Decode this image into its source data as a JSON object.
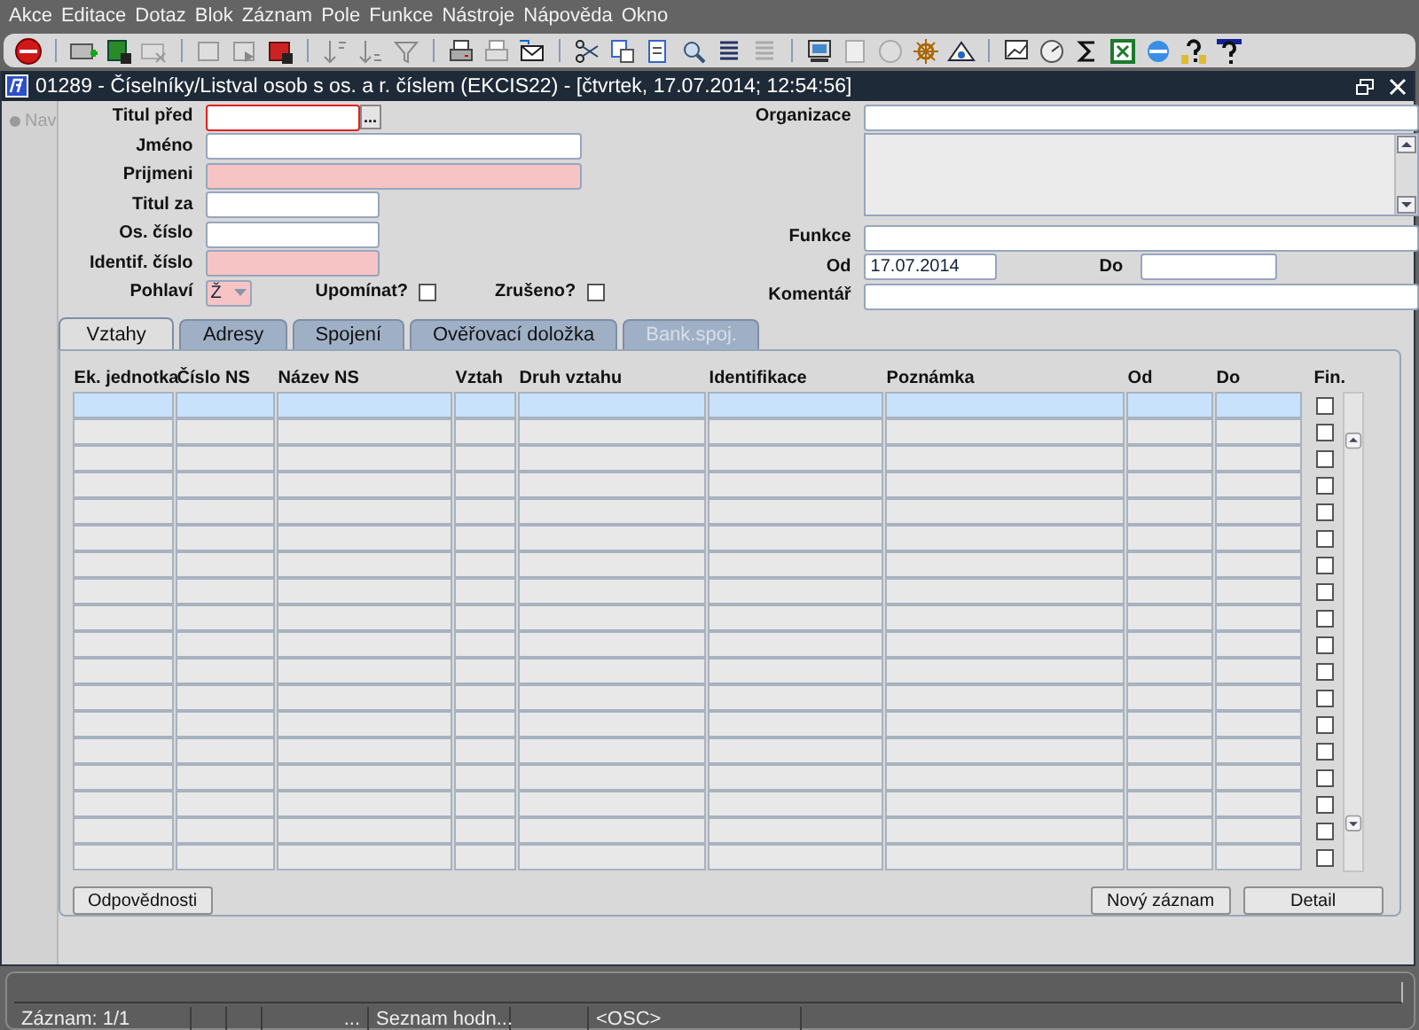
{
  "menu": [
    {
      "label": "Akce"
    },
    {
      "label": "Editace"
    },
    {
      "label": "Dotaz"
    },
    {
      "label": "Blok"
    },
    {
      "label": "Záznam"
    },
    {
      "label": "Pole"
    },
    {
      "label": "Funkce"
    },
    {
      "label": "Nástroje"
    },
    {
      "label": "Nápověda"
    },
    {
      "label": "Okno"
    }
  ],
  "window": {
    "title": "01289 - Číselníky/Listval osob s os. a r. číslem (EKCIS22) - [čtvrtek, 17.07.2014; 12:54:56]",
    "nav": "Nav"
  },
  "form_left": [
    {
      "label": "Titul před",
      "kind": "lookup",
      "required": false,
      "focused": true,
      "button_label": "..."
    },
    {
      "label": "Jméno",
      "kind": "text",
      "required": false,
      "focused": false
    },
    {
      "label": "Prijmeni",
      "kind": "text",
      "required": true,
      "focused": false
    },
    {
      "label": "Titul za",
      "kind": "text",
      "required": false,
      "focused": false
    },
    {
      "label": "Os. číslo",
      "kind": "text",
      "required": false,
      "focused": false
    },
    {
      "label": "Identif. číslo",
      "kind": "text",
      "required": true,
      "focused": false
    },
    {
      "label": "Pohlaví",
      "kind": "select",
      "required": true,
      "focused": false,
      "value": "Ž",
      "checks": [
        {
          "label": "Upomínat?",
          "checked": false
        },
        {
          "label": "Zrušeno?",
          "checked": false
        }
      ]
    }
  ],
  "form_right": [
    {
      "label": "Organizace",
      "kind": "text"
    },
    {
      "kind": "textarea"
    },
    {
      "label": "Funkce",
      "kind": "text"
    },
    {
      "label": "Od",
      "kind": "range",
      "value": "17.07.2014",
      "to_label": "Do"
    },
    {
      "label": "Komentář",
      "kind": "text"
    }
  ],
  "tabs": [
    {
      "label": "Vztahy",
      "selected": true,
      "disabled": false
    },
    {
      "label": "Adresy",
      "selected": false,
      "disabled": false
    },
    {
      "label": "Spojení",
      "selected": false,
      "disabled": false
    },
    {
      "label": "Ověřovací doložka",
      "selected": false,
      "disabled": false
    },
    {
      "label": "Bank.spoj.",
      "selected": false,
      "disabled": true
    }
  ],
  "table": {
    "columns": [
      "Ek. jednotka",
      "Číslo NS",
      "Název NS",
      "Vztah",
      "Druh vztahu",
      "Identifikace",
      "Poznámka",
      "Od",
      "Do",
      "Fin."
    ],
    "rows": [
      {
        "selected": true,
        "fin": false
      },
      {
        "selected": false,
        "fin": false
      },
      {
        "selected": false,
        "fin": false
      },
      {
        "selected": false,
        "fin": false
      },
      {
        "selected": false,
        "fin": false
      },
      {
        "selected": false,
        "fin": false
      },
      {
        "selected": false,
        "fin": false
      },
      {
        "selected": false,
        "fin": false
      },
      {
        "selected": false,
        "fin": false
      },
      {
        "selected": false,
        "fin": false
      },
      {
        "selected": false,
        "fin": false
      },
      {
        "selected": false,
        "fin": false
      },
      {
        "selected": false,
        "fin": false
      },
      {
        "selected": false,
        "fin": false
      },
      {
        "selected": false,
        "fin": false
      },
      {
        "selected": false,
        "fin": false
      },
      {
        "selected": false,
        "fin": false
      },
      {
        "selected": false,
        "fin": false
      }
    ]
  },
  "buttons_left": [
    "Odpovědnosti"
  ],
  "buttons_right": [
    "Nový záznam",
    "Detail"
  ],
  "status_bar": [
    {
      "kind": "text",
      "text": "Záznam: 1/1"
    },
    {
      "kind": "blank"
    },
    {
      "kind": "blank"
    },
    {
      "kind": "text",
      "text": "..."
    },
    {
      "kind": "text",
      "text": "Seznam hodn..."
    },
    {
      "kind": "blank"
    },
    {
      "kind": "text",
      "text": "<OSC>"
    }
  ]
}
